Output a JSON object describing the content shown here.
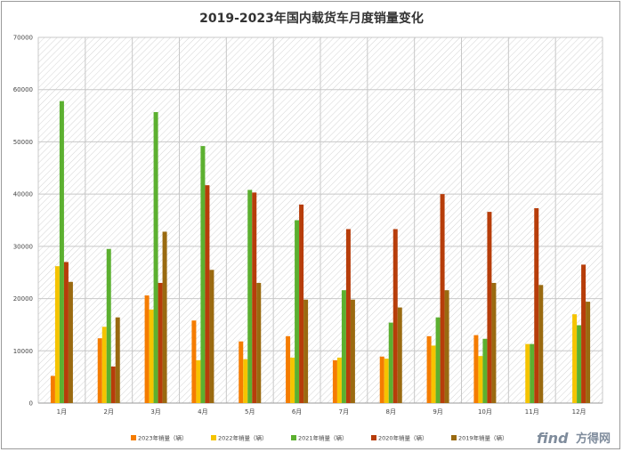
{
  "chart_data": {
    "type": "bar",
    "title": "2019-2023年国内载货车月度销量变化",
    "categories": [
      "1月",
      "2月",
      "3月",
      "4月",
      "5月",
      "6月",
      "7月",
      "8月",
      "9月",
      "10月",
      "11月",
      "12月"
    ],
    "ylim": [
      0,
      70000
    ],
    "yticks": [
      0,
      10000,
      20000,
      30000,
      40000,
      50000,
      60000,
      70000
    ],
    "grid": true,
    "legend_position": "bottom",
    "series": [
      {
        "name": "2023年销量（辆）",
        "color": "#f57c00",
        "values": [
          5200,
          12400,
          20600,
          15800,
          11800,
          12800,
          8200,
          8900,
          12800,
          13000,
          null,
          null
        ]
      },
      {
        "name": "2022年销量（辆）",
        "color": "#f5c400",
        "values": [
          26200,
          14600,
          17900,
          8200,
          8400,
          8700,
          8700,
          8500,
          11000,
          9000,
          11300,
          17000
        ]
      },
      {
        "name": "2021年销量（辆）",
        "color": "#5cb030",
        "values": [
          57800,
          29500,
          55700,
          49200,
          40800,
          35000,
          21600,
          15400,
          16400,
          12300,
          11300,
          14900
        ]
      },
      {
        "name": "2020年销量（辆）",
        "color": "#b73d0a",
        "values": [
          27000,
          7000,
          23000,
          41700,
          40300,
          38000,
          33300,
          33300,
          40000,
          36600,
          37300,
          26500
        ]
      },
      {
        "name": "2019年销量（辆）",
        "color": "#9a6a10",
        "values": [
          23200,
          16400,
          32800,
          25500,
          23000,
          19800,
          19800,
          18300,
          21600,
          23000,
          22600,
          19400
        ]
      }
    ]
  },
  "watermark": {
    "brand_en": "find",
    "brand_cn": "方得网"
  }
}
